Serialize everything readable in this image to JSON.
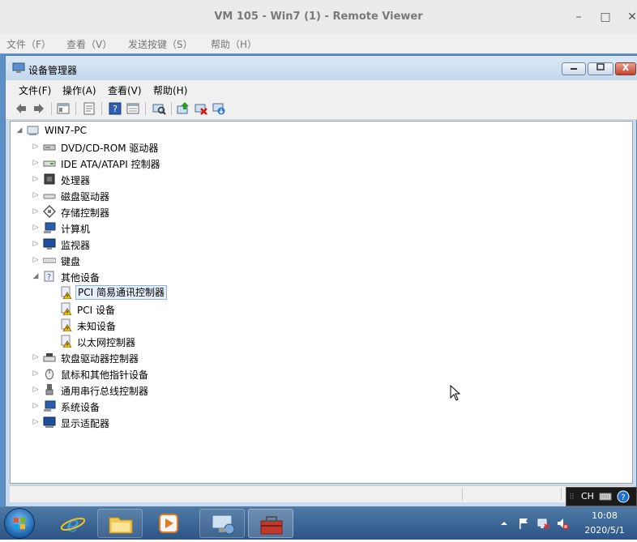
{
  "viewer": {
    "title": "VM 105 - Win7 (1) - Remote Viewer",
    "controls": {
      "minimize": "–",
      "maximize": "□",
      "close": "✕"
    },
    "menu": [
      "文件（F）",
      "查看（V）",
      "发送按键（S）",
      "帮助（H）"
    ]
  },
  "window": {
    "title": "设备管理器",
    "menu": [
      "文件(F)",
      "操作(A)",
      "查看(V)",
      "帮助(H)"
    ],
    "toolbar_icons": [
      "back-icon",
      "forward-icon",
      "up-icon",
      "properties-icon",
      "help-icon",
      "view-icon",
      "scan-hardware-icon",
      "update-driver-icon",
      "uninstall-icon",
      "enable-device-icon"
    ]
  },
  "tree": {
    "root": "WIN7-PC",
    "items": [
      {
        "label": "DVD/CD-ROM 驱动器",
        "icon": "dvd-drive-icon",
        "expanded": false
      },
      {
        "label": "IDE ATA/ATAPI 控制器",
        "icon": "ide-controller-icon",
        "expanded": false
      },
      {
        "label": "处理器",
        "icon": "processor-icon",
        "expanded": false
      },
      {
        "label": "磁盘驱动器",
        "icon": "disk-drive-icon",
        "expanded": false
      },
      {
        "label": "存储控制器",
        "icon": "storage-controller-icon",
        "expanded": false
      },
      {
        "label": "计算机",
        "icon": "computer-icon",
        "expanded": false
      },
      {
        "label": "监视器",
        "icon": "monitor-icon",
        "expanded": false
      },
      {
        "label": "键盘",
        "icon": "keyboard-icon",
        "expanded": false
      },
      {
        "label": "其他设备",
        "icon": "unknown-device-icon",
        "expanded": true,
        "children": [
          {
            "label": "PCI 简易通讯控制器",
            "icon": "warning-device-icon",
            "selected": true
          },
          {
            "label": "PCI 设备",
            "icon": "warning-device-icon"
          },
          {
            "label": "未知设备",
            "icon": "warning-device-icon"
          },
          {
            "label": "以太网控制器",
            "icon": "warning-device-icon"
          }
        ]
      },
      {
        "label": "软盘驱动器控制器",
        "icon": "floppy-controller-icon",
        "expanded": false
      },
      {
        "label": "鼠标和其他指针设备",
        "icon": "mouse-icon",
        "expanded": false
      },
      {
        "label": "通用串行总线控制器",
        "icon": "usb-controller-icon",
        "expanded": false
      },
      {
        "label": "系统设备",
        "icon": "system-device-icon",
        "expanded": false
      },
      {
        "label": "显示适配器",
        "icon": "display-adapter-icon",
        "expanded": false
      }
    ]
  },
  "language_bar": {
    "label": "CH"
  },
  "clock": {
    "time": "10:08",
    "date": "2020/5/1"
  },
  "colors": {
    "taskbar": "#2c5586",
    "selection": "#e6f0fb",
    "close_button": "#c5422c"
  }
}
